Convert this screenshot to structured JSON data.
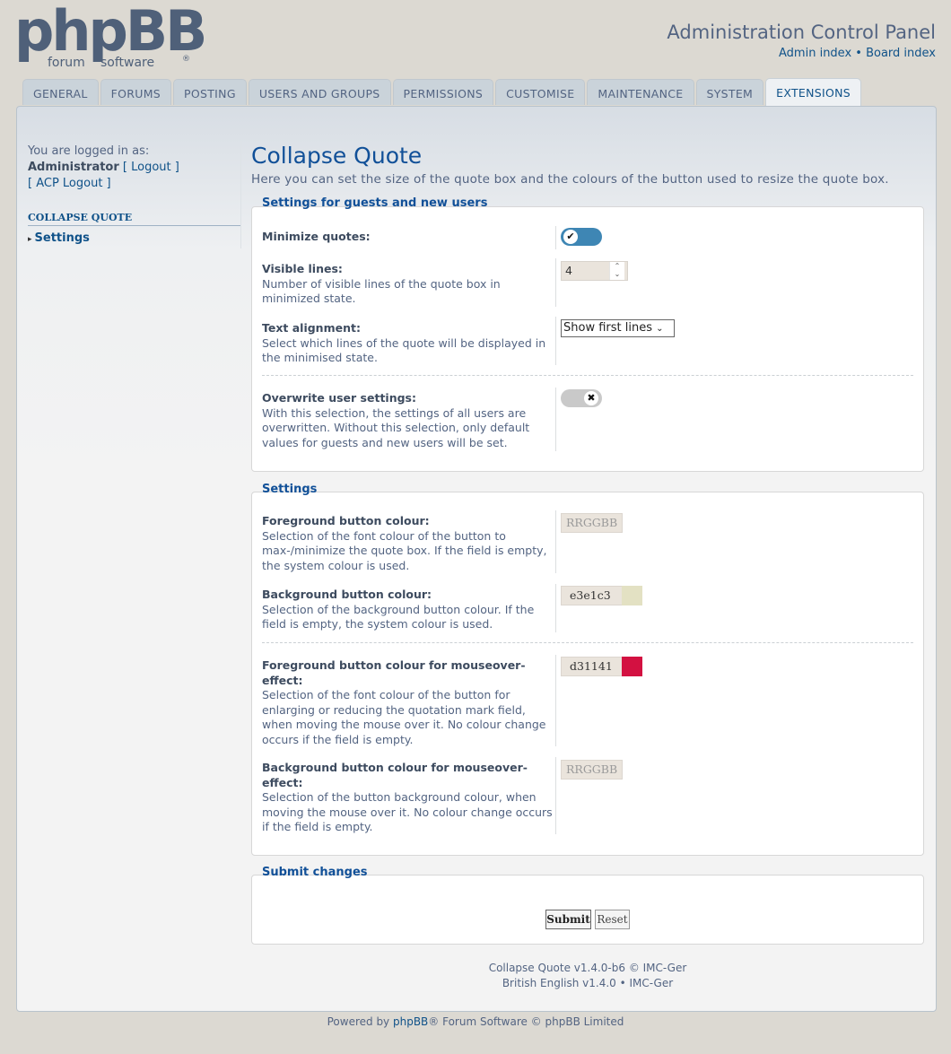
{
  "header": {
    "logo_main": "phpBB",
    "logo_sub1": "forum",
    "logo_sub2": "software",
    "logo_reg": "®",
    "title": "Administration Control Panel",
    "link_admin_index": "Admin index",
    "separator": " • ",
    "link_board_index": "Board index"
  },
  "tabs": [
    "GENERAL",
    "FORUMS",
    "POSTING",
    "USERS AND GROUPS",
    "PERMISSIONS",
    "CUSTOMISE",
    "MAINTENANCE",
    "SYSTEM",
    "EXTENSIONS"
  ],
  "active_tab": "EXTENSIONS",
  "sidebar": {
    "logged_in_as": "You are logged in as:",
    "username": "Administrator",
    "logout": "[ Logout ]",
    "acp_logout": "[ ACP Logout ]",
    "menu_heading": "COLLAPSE QUOTE",
    "menu_item": "Settings"
  },
  "main": {
    "title": "Collapse Quote",
    "description": "Here you can set the size of the quote box and the colours of the button used to resize the quote box."
  },
  "guests": {
    "legend": "Settings for guests and new users",
    "minimize_label": "Minimize quotes:",
    "minimize_value": true,
    "visible_label": "Visible lines:",
    "visible_desc": "Number of visible lines of the quote box in minimized state.",
    "visible_value": "4",
    "align_label": "Text alignment:",
    "align_desc": "Select which lines of the quote will be displayed in the minimised state.",
    "align_value": "Show first lines",
    "overwrite_label": "Overwrite user settings:",
    "overwrite_desc": "With this selection, the settings of all users are overwritten. Without this selection, only default values for guests and new users will be set.",
    "overwrite_value": false
  },
  "settings": {
    "legend": "Settings",
    "fg_label": "Foreground button colour:",
    "fg_desc": "Selection of the font colour of the button to max-/minimize the quote box. If the field is empty, the system colour is used.",
    "fg_placeholder": "RRGGBB",
    "bg_label": "Background button colour:",
    "bg_desc": "Selection of the background button colour. If the field is empty, the system colour is used.",
    "bg_value": "e3e1c3",
    "bg_color": "#e3e1c3",
    "fg_hover_label": "Foreground button colour for mouseover-effect:",
    "fg_hover_desc": "Selection of the font colour of the button for enlarging or reducing the quotation mark field, when moving the mouse over it. No colour change occurs if the field is empty.",
    "fg_hover_value": "d31141",
    "fg_hover_color": "#d31141",
    "bg_hover_label": "Background button colour for mouseover-effect:",
    "bg_hover_desc": "Selection of the button background colour, when moving the mouse over it. No colour change occurs if the field is empty.",
    "bg_hover_placeholder": "RRGGBB"
  },
  "submit": {
    "legend": "Submit changes",
    "submit_label": "Submit",
    "reset_label": "Reset"
  },
  "footer": {
    "ext_version": "Collapse Quote v1.4.0-b6 © IMC-Ger",
    "lang_version": "British English v1.4.0 • IMC-Ger",
    "powered_prefix": "Powered by ",
    "powered_link": "phpBB",
    "powered_suffix": "® Forum Software © phpBB Limited"
  },
  "colors": {
    "brand_blue": "#105289",
    "text": "#536482",
    "toggle_on": "#3e86b4"
  }
}
